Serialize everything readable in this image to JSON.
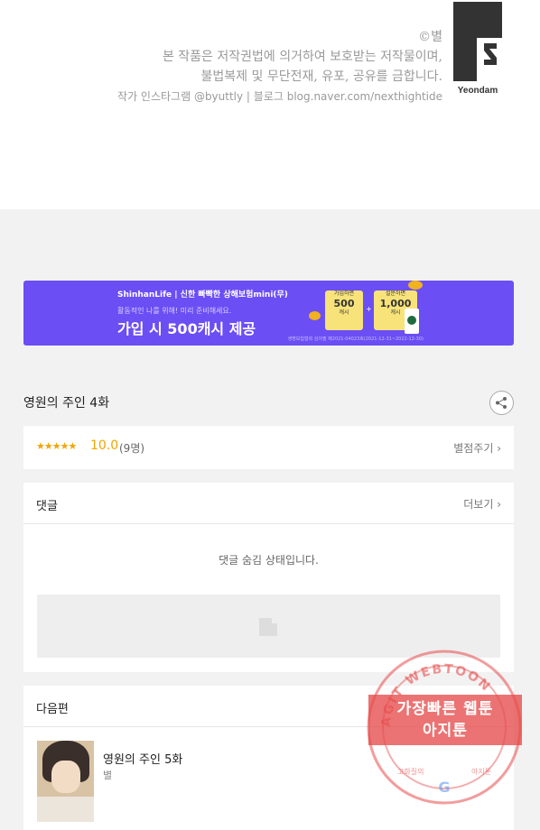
{
  "credit": {
    "copyright": "©별",
    "line1": "본 작품은 저작권법에 의거하여 보호받는 저작물이며,",
    "line2": "불법복제 및 무단전재, 유포, 공유를 금합니다.",
    "line3": "작가 인스타그램 @byuttly | 블로그 blog.naver.com/nexthightide",
    "publisher": "Yeondam"
  },
  "banner": {
    "brand": "ShinhanLife | 신한 빠빡한 상해보험mini(무)",
    "subtitle": "활동적인 나를 위해! 미리 준비해세요.",
    "headline": "가입 시 500캐시 제공",
    "card1_top": "가입하면",
    "card1_value": "500",
    "card1_unit": "캐시",
    "card2_top": "설문하면",
    "card2_value": "1,000",
    "card2_unit": "캐시",
    "note": "생명보험협회 심의필 제2021-04023호(2021-12-31~2022-12-30)",
    "color": "#6b4ef4"
  },
  "episode": {
    "title": "영원의 주인 4화",
    "share_icon": "share-icon"
  },
  "rating": {
    "stars": "★★★★★",
    "score": "10.0",
    "count": "(9명)",
    "rate_link": "별점주기 ›",
    "star_color": "#f0a500"
  },
  "comments": {
    "title": "댓글",
    "more": "더보기 ›",
    "hidden_message": "댓글 숨김 상태입니다."
  },
  "next_episode": {
    "section_title": "다음편",
    "title": "영원의 주인 5화",
    "author": "별"
  },
  "watermark": {
    "ring_text": "AGIT WEBTOON",
    "line1": "가장빠른 웹툰",
    "line2": "아지툰",
    "bottom_left": "고화질의",
    "bottom_right": "아지툰",
    "color": "#e74c4c"
  }
}
